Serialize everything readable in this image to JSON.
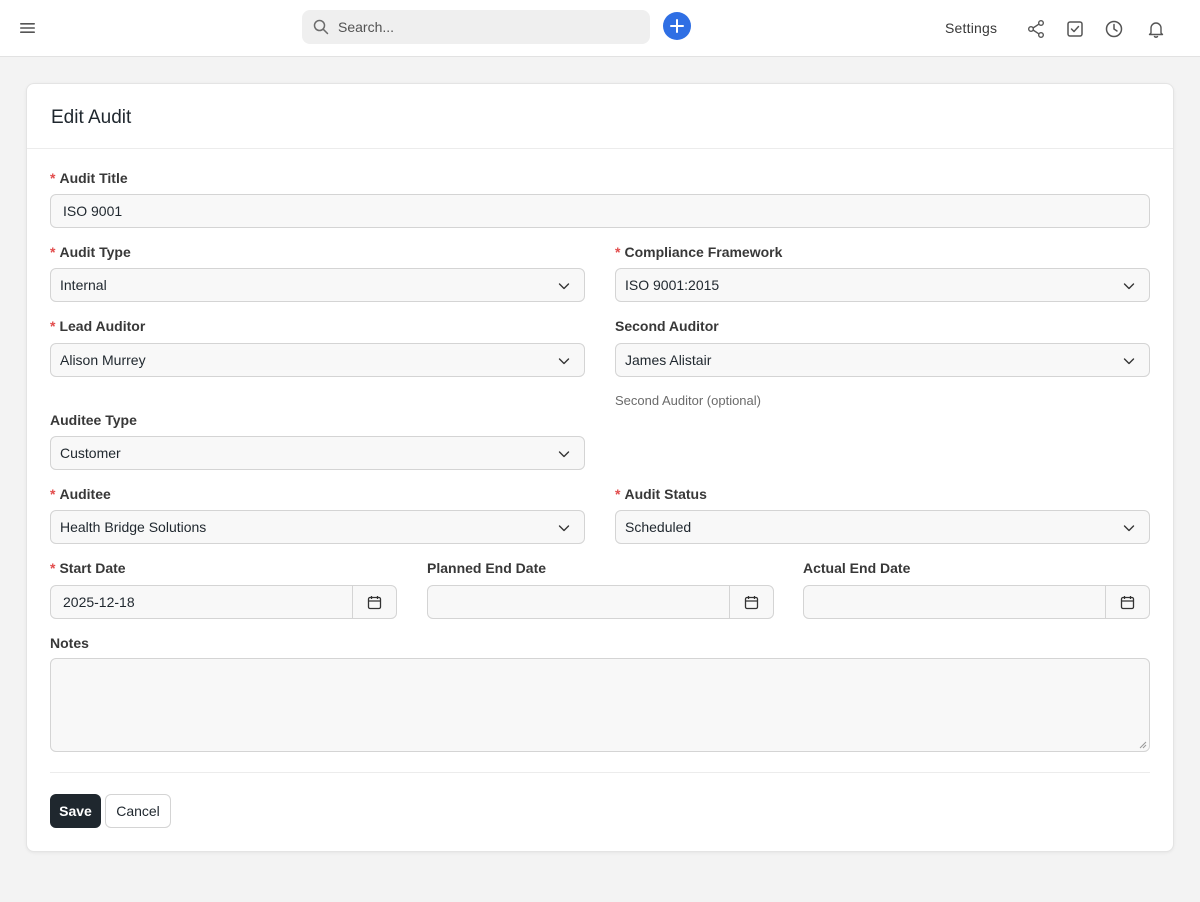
{
  "navbar": {
    "menu_icon": "hamburger-icon",
    "search_placeholder": "Search...",
    "add_icon": "plus-icon",
    "settings_label": "Settings",
    "icons": [
      "share-icon",
      "checkbox-icon",
      "clock-icon",
      "bell-icon"
    ],
    "accent": "#2f6fe4"
  },
  "form": {
    "title": "Edit Audit",
    "required_marker": "*",
    "fields": {
      "audit_title": {
        "label": "Audit Title",
        "value": "ISO 9001"
      },
      "audit_type": {
        "label": "Audit Type",
        "value": "Internal"
      },
      "compliance_framework": {
        "label": "Compliance Framework",
        "value": "ISO 9001:2015"
      },
      "lead_auditor": {
        "label": "Lead Auditor",
        "value": "Alison Murrey"
      },
      "second_auditor": {
        "label": "Second Auditor",
        "value": "James Alistair",
        "hint": "Second Auditor (optional)"
      },
      "auditee_type": {
        "label": "Auditee Type",
        "value": "Customer"
      },
      "auditee": {
        "label": "Auditee",
        "value": "Health Bridge Solutions"
      },
      "audit_status": {
        "label": "Audit Status",
        "value": "Scheduled"
      },
      "start_date": {
        "label": "Start Date",
        "value": "2025-12-18"
      },
      "planned_end_date": {
        "label": "Planned End Date",
        "value": ""
      },
      "actual_end_date": {
        "label": "Actual End Date",
        "value": ""
      },
      "notes": {
        "label": "Notes",
        "value": ""
      }
    },
    "save_label": "Save",
    "cancel_label": "Cancel",
    "required_color": "#e24c4c",
    "primary_button_color": "#1f272e"
  }
}
